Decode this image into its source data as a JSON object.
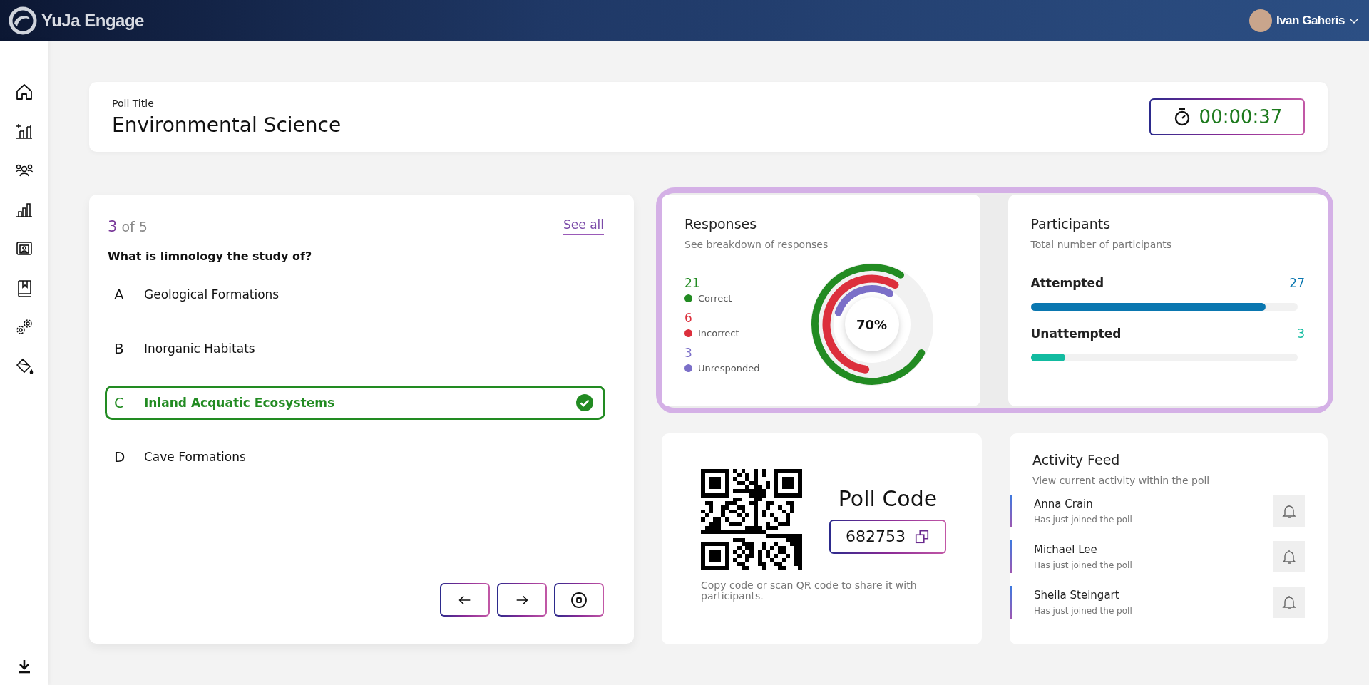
{
  "app": {
    "name": "YuJa Engage"
  },
  "user": {
    "name": "Ivan Gaheris"
  },
  "poll": {
    "label": "Poll Title",
    "title": "Environmental Science",
    "timer": "00:00:37"
  },
  "question": {
    "current": "3",
    "total": "of 5",
    "see_all": "See all",
    "text": "What is limnology the study of?",
    "options": [
      {
        "letter": "A",
        "text": "Geological Formations",
        "correct": false
      },
      {
        "letter": "B",
        "text": "Inorganic Habitats",
        "correct": false
      },
      {
        "letter": "C",
        "text": "Inland Acquatic Ecosystems",
        "correct": true
      },
      {
        "letter": "D",
        "text": "Cave Formations",
        "correct": false
      }
    ]
  },
  "responses": {
    "title": "Responses",
    "subtitle": "See breakdown of responses",
    "center": "70%",
    "items": [
      {
        "count": "21",
        "label": "Correct",
        "color": "#228b22"
      },
      {
        "count": "6",
        "label": "Incorrect",
        "color": "#dc2f3c"
      },
      {
        "count": "3",
        "label": "Unresponded",
        "color": "#7b6fc8"
      }
    ]
  },
  "participants": {
    "title": "Participants",
    "subtitle": "Total number of participants",
    "rows": [
      {
        "label": "Attempted",
        "count": "27",
        "color": "#0a77b0",
        "level": 0.88
      },
      {
        "label": "Unattempted",
        "count": "3",
        "color": "#12bba0",
        "level": 0.13
      }
    ]
  },
  "poll_code": {
    "heading": "Poll Code",
    "code": "682753",
    "hint": "Copy code or scan QR code to share it with participants."
  },
  "activity": {
    "title": "Activity Feed",
    "subtitle": "View current activity within the poll",
    "entries": [
      {
        "name": "Anna Crain",
        "text": "Has just joined the poll"
      },
      {
        "name": "Michael Lee",
        "text": "Has just joined the poll"
      },
      {
        "name": "Sheila Steingart",
        "text": "Has just joined the poll"
      }
    ]
  }
}
